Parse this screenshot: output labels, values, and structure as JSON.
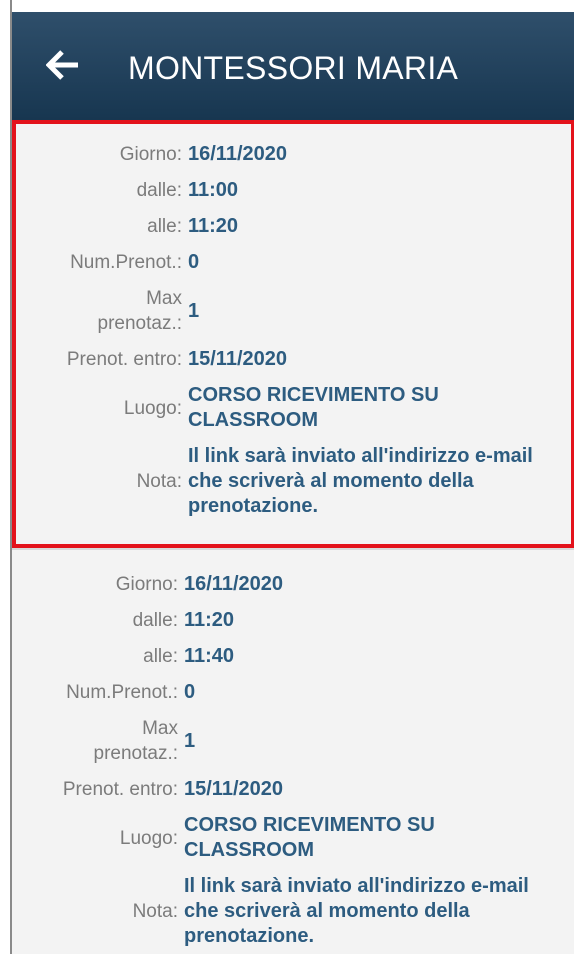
{
  "header": {
    "title": "MONTESSORI MARIA",
    "back_icon": "arrow-left-icon"
  },
  "labels": {
    "giorno": "Giorno:",
    "dalle": "dalle:",
    "alle": "alle:",
    "num_prenot": "Num.Prenot.:",
    "max_line1": "Max",
    "max_line2": "prenotaz.:",
    "prenot_entro": "Prenot. entro:",
    "luogo": "Luogo:",
    "nota": "Nota:"
  },
  "slots": [
    {
      "giorno": "16/11/2020",
      "dalle": "11:00",
      "alle": "11:20",
      "num_prenot": "0",
      "max_prenot": "1",
      "prenot_entro": "15/11/2020",
      "luogo": "CORSO RICEVIMENTO SU CLASSROOM",
      "nota": "Il link sarà inviato all'indirizzo e-mail che scriverà al momento della prenotazione."
    },
    {
      "giorno": "16/11/2020",
      "dalle": "11:20",
      "alle": "11:40",
      "num_prenot": "0",
      "max_prenot": "1",
      "prenot_entro": "15/11/2020",
      "luogo": "CORSO RICEVIMENTO SU CLASSROOM",
      "nota": "Il link sarà inviato all'indirizzo e-mail che scriverà al momento della prenotazione."
    }
  ],
  "colors": {
    "header": "#1f4058",
    "value_text": "#2d5c80",
    "label_text": "#7b7b7b",
    "selection_border": "#e3121b"
  }
}
